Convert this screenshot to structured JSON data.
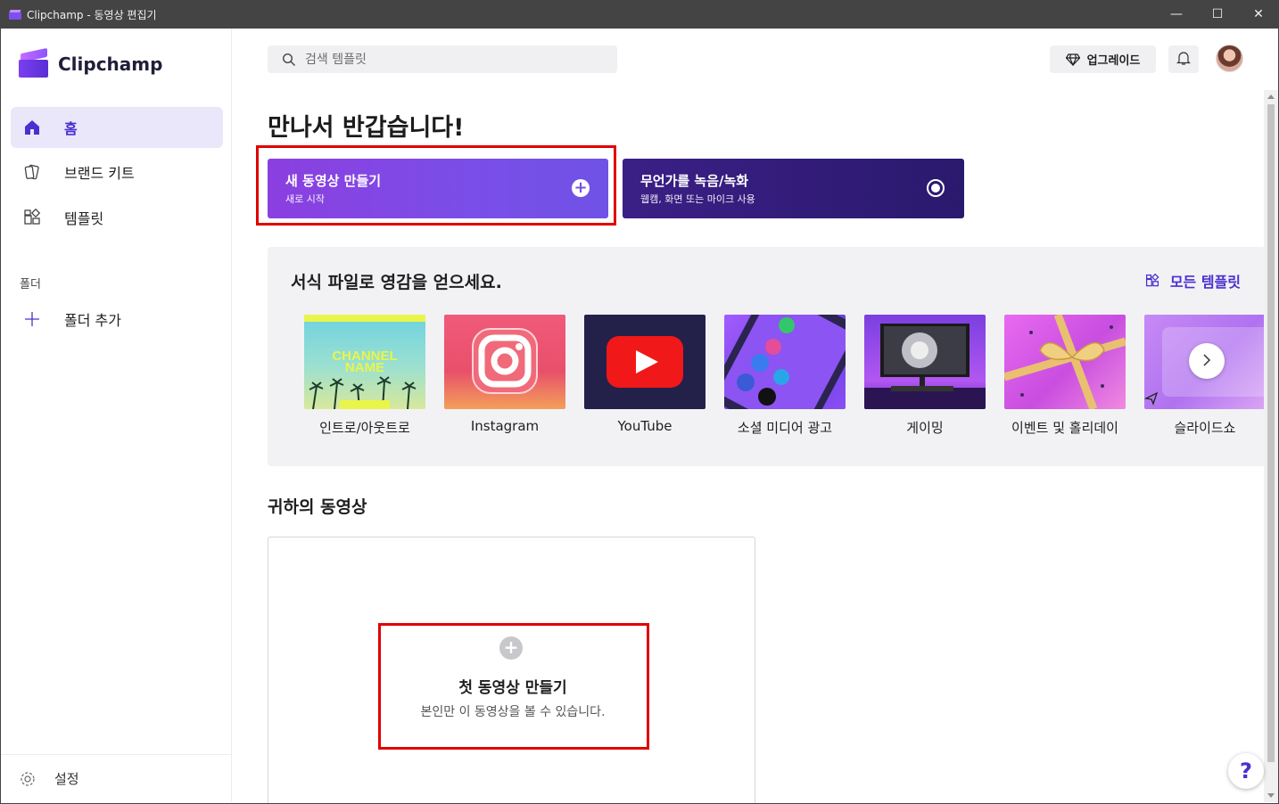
{
  "window": {
    "title": "Clipchamp - 동영상 편집기",
    "minimize_glyph": "—",
    "maximize_glyph": "☐",
    "close_glyph": "✕"
  },
  "sidebar": {
    "brand": "Clipchamp",
    "items": [
      {
        "label": "홈",
        "icon": "home-icon",
        "active": true
      },
      {
        "label": "브랜드 키트",
        "icon": "brand-kit-icon"
      },
      {
        "label": "템플릿",
        "icon": "templates-icon"
      }
    ],
    "folder_section": "폴더",
    "add_folder": "폴더 추가",
    "settings": "설정"
  },
  "header": {
    "search_placeholder": "검색 템플릿",
    "upgrade": "업그레이드"
  },
  "main": {
    "greeting": "만나서 반갑습니다!",
    "new_video": {
      "title": "새 동영상 만들기",
      "subtitle": "새로 시작"
    },
    "record": {
      "title": "무언가를 녹음/녹화",
      "subtitle": "웹캠, 화면 또는 마이크 사용"
    },
    "templates": {
      "title": "서식 파일로 영감을 얻으세요.",
      "all_link": "모든 템플릿",
      "categories": [
        {
          "label": "인트로/아웃트로",
          "thumb_text": "CHANNEL NAME"
        },
        {
          "label": "Instagram"
        },
        {
          "label": "YouTube"
        },
        {
          "label": "소셜 미디어 광고"
        },
        {
          "label": "게이밍"
        },
        {
          "label": "이벤트 및 홀리데이"
        },
        {
          "label": "슬라이드쇼"
        }
      ]
    },
    "your_videos": {
      "title": "귀하의 동영상",
      "first_title": "첫 동영상 만들기",
      "first_subtitle": "본인만 이 동영상을 볼 수 있습니다."
    }
  },
  "help_glyph": "?",
  "colors": {
    "accent": "#4b2fd0",
    "new_video_bg": "#8b3fe0",
    "record_bg": "#2a1a6e",
    "highlight_box": "#e00000"
  }
}
